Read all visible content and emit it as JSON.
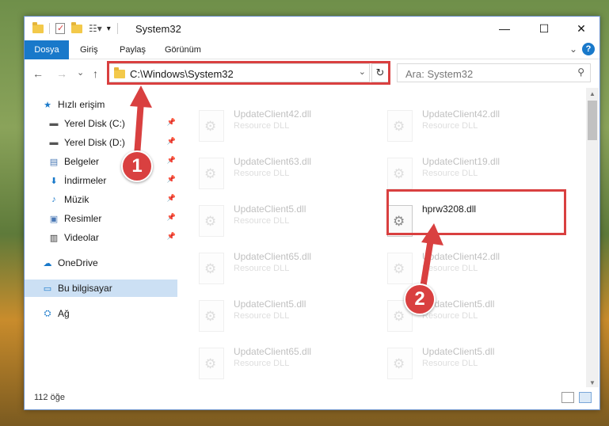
{
  "window": {
    "title": "System32",
    "ribbon_tabs": [
      "Dosya",
      "Giriş",
      "Paylaş",
      "Görünüm"
    ],
    "controls": {
      "minimize": "—",
      "maximize": "☐",
      "close": "✕"
    }
  },
  "nav": {
    "back": "←",
    "forward": "→",
    "recent": "⌄",
    "up": "↑",
    "address": "C:\\Windows\\System32",
    "search_placeholder": "Ara: System32"
  },
  "sidebar": {
    "items": [
      {
        "label": "Hızlı erişim",
        "icon": "star-icon",
        "pinned": false
      },
      {
        "label": "Yerel Disk (C:)",
        "icon": "drive-icon",
        "pinned": true
      },
      {
        "label": "Yerel Disk (D:)",
        "icon": "drive-icon",
        "pinned": true
      },
      {
        "label": "Belgeler",
        "icon": "documents-icon",
        "pinned": true
      },
      {
        "label": "İndirmeler",
        "icon": "download-icon",
        "pinned": true
      },
      {
        "label": "Müzik",
        "icon": "music-icon",
        "pinned": true
      },
      {
        "label": "Resimler",
        "icon": "pictures-icon",
        "pinned": true
      },
      {
        "label": "Videolar",
        "icon": "videos-icon",
        "pinned": true
      },
      {
        "label": "OneDrive",
        "icon": "cloud-icon",
        "pinned": false
      },
      {
        "label": "Bu bilgisayar",
        "icon": "computer-icon",
        "pinned": false,
        "selected": true
      },
      {
        "label": "Ağ",
        "icon": "network-icon",
        "pinned": false
      }
    ]
  },
  "files": [
    {
      "name": "UpdateClient42.dll",
      "type": "Resource DLL",
      "faded": true
    },
    {
      "name": "UpdateClient42.dll",
      "type": "Resource DLL",
      "faded": true
    },
    {
      "name": "UpdateClient63.dll",
      "type": "Resource DLL",
      "faded": true
    },
    {
      "name": "UpdateClient19.dll",
      "type": "Resource DLL",
      "faded": true
    },
    {
      "name": "UpdateClient5.dll",
      "type": "Resource DLL",
      "faded": true
    },
    {
      "name": "hprw3208.dll",
      "type": "",
      "faded": false
    },
    {
      "name": "UpdateClient65.dll",
      "type": "Resource DLL",
      "faded": true
    },
    {
      "name": "UpdateClient42.dll",
      "type": "Resource DLL",
      "faded": true
    },
    {
      "name": "UpdateClient5.dll",
      "type": "Resource DLL",
      "faded": true
    },
    {
      "name": "UpdateClient5.dll",
      "type": "Resource DLL",
      "faded": true
    },
    {
      "name": "UpdateClient65.dll",
      "type": "Resource DLL",
      "faded": true
    },
    {
      "name": "UpdateClient5.dll",
      "type": "Resource DLL",
      "faded": true
    }
  ],
  "status": {
    "item_count": "112 öğe"
  },
  "callouts": {
    "step1": "1",
    "step2": "2"
  },
  "colors": {
    "accent": "#1979ca",
    "highlight": "#d94040",
    "selected": "#cce0f4"
  }
}
